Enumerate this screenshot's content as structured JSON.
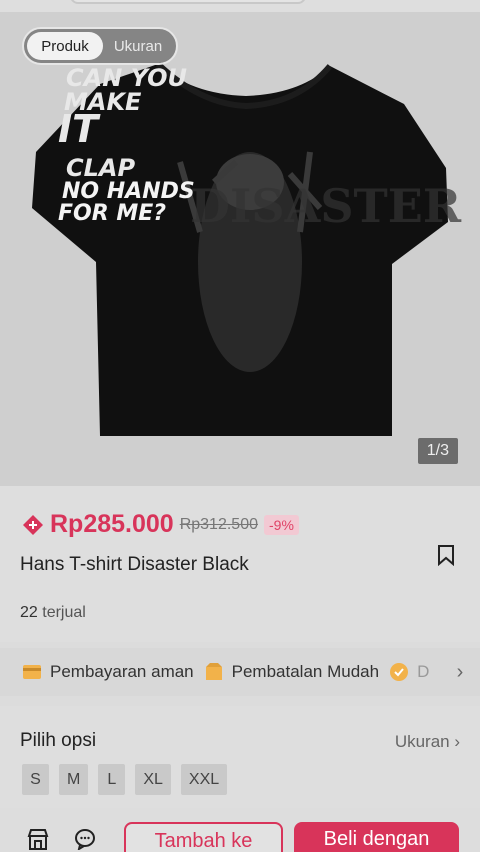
{
  "hero": {
    "toggle_active": "Produk",
    "toggle_inactive": "Ukuran",
    "shirt_print": [
      "CAN YOU",
      "MAKE",
      "IT",
      "CLAP",
      "NO HANDS",
      "FOR ME?"
    ],
    "counter": "1/3"
  },
  "product": {
    "price": "Rp285.000",
    "original_price": "Rp312.500",
    "discount": "-9%",
    "title": "Hans T-shirt Disaster Black",
    "sold_count": "22",
    "sold_label": "terjual"
  },
  "benefits": {
    "items": [
      "Pembayaran aman",
      "Pembatalan Mudah",
      "D"
    ],
    "chevron": "›"
  },
  "options": {
    "title": "Pilih opsi",
    "link": "Ukuran ›",
    "sizes": [
      "S",
      "M",
      "L",
      "XL",
      "XXL"
    ]
  },
  "actions": {
    "add_label": "Tambah ke",
    "buy_label": "Beli dengan"
  },
  "colors": {
    "accent": "#d8345a",
    "discount_bg": "#f2c9d3"
  }
}
